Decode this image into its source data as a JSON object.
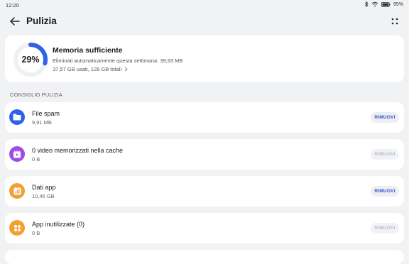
{
  "status": {
    "time": "12:20",
    "battery": "95%"
  },
  "header": {
    "title": "Pulizia"
  },
  "storage": {
    "percent_label": "29%",
    "percent_value": 0.29,
    "title": "Memoria sufficiente",
    "auto_deleted": "Eliminati automaticamente questa settimana: 39,93 MB",
    "usage": "37,57 GB usati, 128 GB totali"
  },
  "section": {
    "label": "CONSIGLIO PULIZIA"
  },
  "items": [
    {
      "title": "File spam",
      "subtitle": "9,91 MB",
      "button": "RIMUOVI",
      "icon": "folder-icon",
      "color": "#2f62e8",
      "enabled": true
    },
    {
      "title": "0 video memorizzati nella cache",
      "subtitle": "0 B",
      "button": "RIMUOVI",
      "icon": "video-icon",
      "color": "#9b4de6",
      "enabled": false
    },
    {
      "title": "Dati app",
      "subtitle": "10,45 GB",
      "button": "RIMUOVI",
      "icon": "app-data-icon",
      "color": "#f2a033",
      "enabled": true
    },
    {
      "title": "App inutilizzate (0)",
      "subtitle": "0 B",
      "button": "RIMUOVI",
      "icon": "apps-grid-icon",
      "color": "#f2a033",
      "enabled": false
    }
  ],
  "colors": {
    "accent": "#2f62e8",
    "ring_track": "#eef0f4",
    "background": "#f1f2f4"
  }
}
